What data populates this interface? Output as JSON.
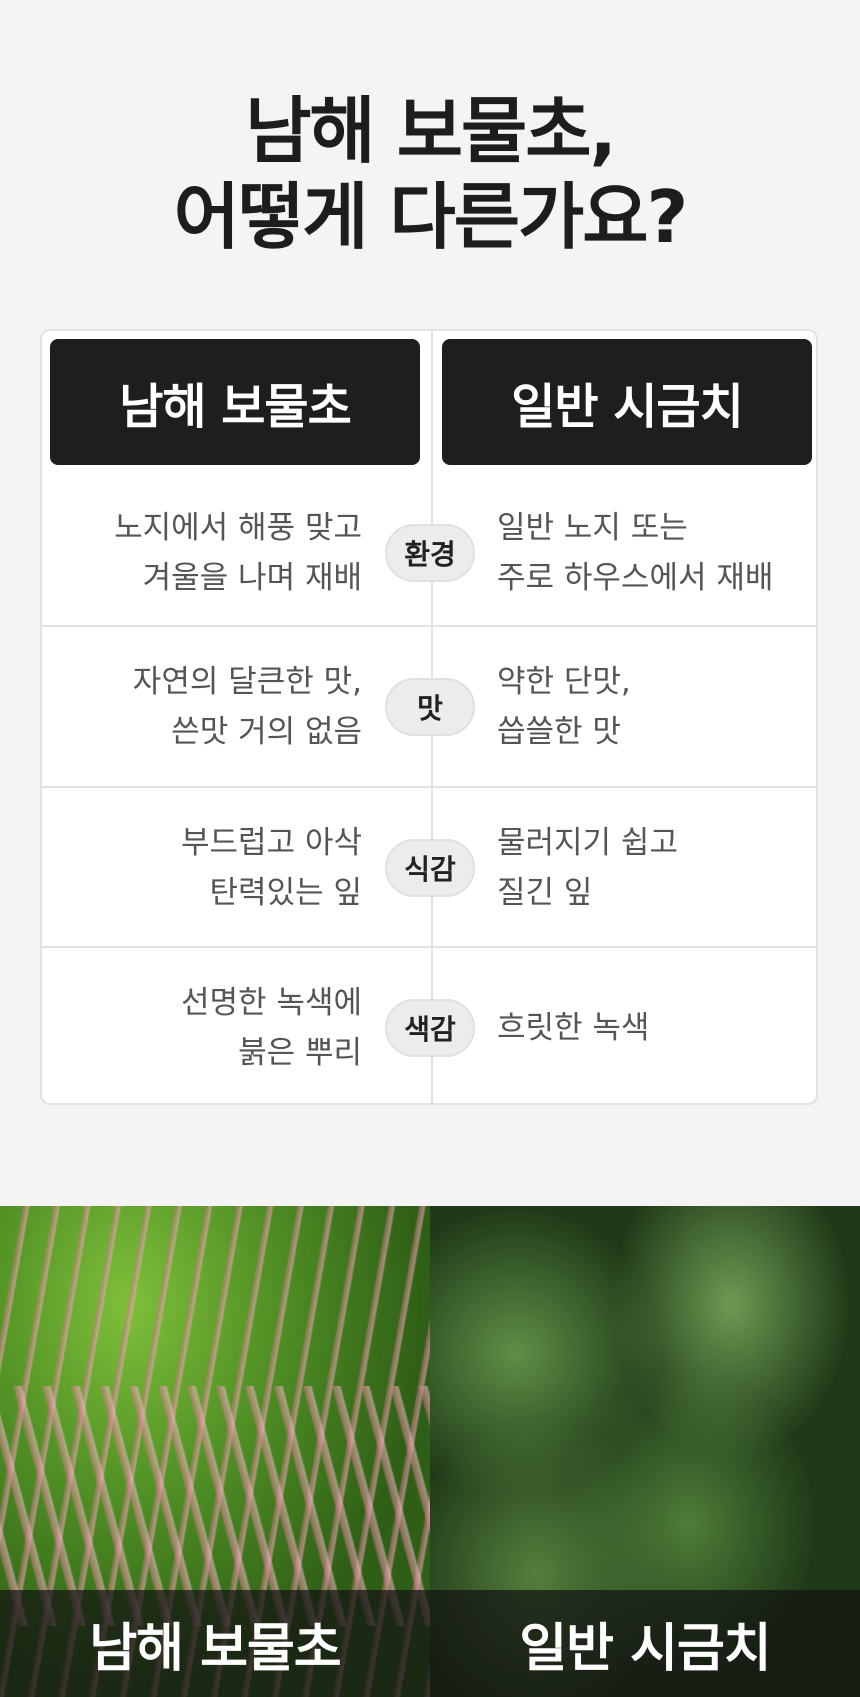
{
  "title": {
    "line1": "남해 보물초,",
    "line2": "어떻게 다른가요?"
  },
  "table": {
    "header_left": "남해 보물초",
    "header_right": "일반 시금치",
    "rows": [
      {
        "label": "환경",
        "left": [
          "노지에서 해풍 맞고",
          "겨울을 나며 재배"
        ],
        "right": [
          "일반 노지 또는",
          "주로 하우스에서 재배"
        ]
      },
      {
        "label": "맛",
        "left": [
          "자연의 달큰한 맛,",
          "쓴맛 거의 없음"
        ],
        "right": [
          "약한 단맛,",
          "씁쓸한 맛"
        ]
      },
      {
        "label": "식감",
        "left": [
          "부드럽고 아삭",
          "탄력있는 잎"
        ],
        "right": [
          "물러지기 쉽고",
          "질긴 잎"
        ]
      },
      {
        "label": "색감",
        "left": [
          "선명한 녹색에",
          "붉은 뿌리"
        ],
        "right": [
          "흐릿한 녹색"
        ]
      }
    ]
  },
  "photos": {
    "left_caption": "남해 보물초",
    "right_caption": "일반 시금치"
  }
}
